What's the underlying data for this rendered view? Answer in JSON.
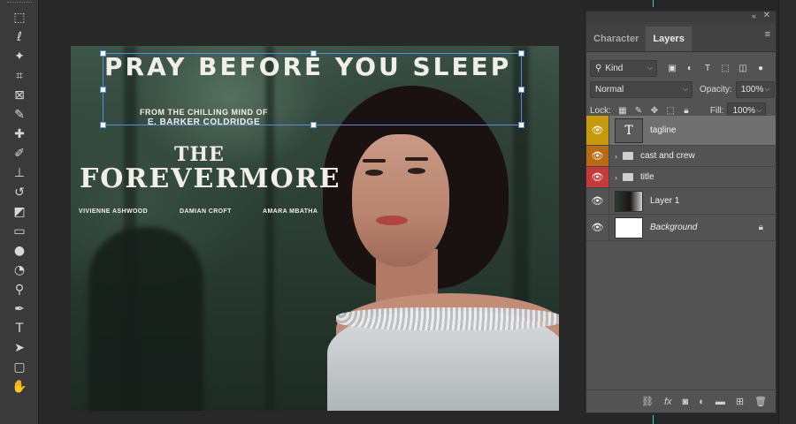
{
  "toolbar": {
    "tools": [
      {
        "icon": "rect-marquee-icon",
        "glyph": "⬚"
      },
      {
        "icon": "lasso-icon",
        "glyph": "ℓ"
      },
      {
        "icon": "magic-wand-icon",
        "glyph": "✦"
      },
      {
        "icon": "crop-icon",
        "glyph": "⌗"
      },
      {
        "icon": "frame-icon",
        "glyph": "⊠"
      },
      {
        "icon": "eyedropper-icon",
        "glyph": "✎"
      },
      {
        "icon": "healing-brush-icon",
        "glyph": "✚"
      },
      {
        "icon": "brush-icon",
        "glyph": "✐"
      },
      {
        "icon": "clone-stamp-icon",
        "glyph": "⊥"
      },
      {
        "icon": "history-brush-icon",
        "glyph": "↺"
      },
      {
        "icon": "eraser-icon",
        "glyph": "◩"
      },
      {
        "icon": "gradient-icon",
        "glyph": "▭"
      },
      {
        "icon": "blur-icon",
        "glyph": "●"
      },
      {
        "icon": "dodge-icon",
        "glyph": "◔"
      },
      {
        "icon": "zoom-icon",
        "glyph": "⚲"
      },
      {
        "icon": "pen-icon",
        "glyph": "✒"
      },
      {
        "icon": "type-icon",
        "glyph": "T"
      },
      {
        "icon": "path-select-icon",
        "glyph": "➤"
      },
      {
        "icon": "rectangle-shape-icon",
        "glyph": "▢"
      },
      {
        "icon": "hand-icon",
        "glyph": "✋"
      }
    ]
  },
  "poster": {
    "tagline": "PRAY BEFORE YOU SLEEP",
    "from_line_1": "FROM THE CHILLING MIND OF",
    "from_line_2": "E. BARKER COLDRIDGE",
    "title_the": "THE",
    "title_main": "FOREVERMORE",
    "cast": [
      "VIVIENNE ASHWOOD",
      "DAMIAN CROFT",
      "AMARA MBATHA"
    ]
  },
  "panel": {
    "tabs": [
      "Character",
      "Layers"
    ],
    "active_tab": "Layers",
    "filter_kind": "Kind",
    "blend_mode": "Normal",
    "opacity_label": "Opacity:",
    "opacity_value": "100%",
    "lock_label": "Lock:",
    "fill_label": "Fill:",
    "fill_value": "100%",
    "layers": [
      {
        "name": "tagline",
        "type": "text",
        "color": "#c69a0d",
        "selected": true
      },
      {
        "name": "cast and crew",
        "type": "group",
        "color": "#b86b12"
      },
      {
        "name": "title",
        "type": "group",
        "color": "#c43b3b"
      },
      {
        "name": "Layer 1",
        "type": "image"
      },
      {
        "name": "Background",
        "type": "background",
        "locked": true
      }
    ],
    "footer_icons": [
      "link-icon",
      "fx-icon",
      "mask-icon",
      "adjustment-icon",
      "new-group-icon",
      "new-layer-icon",
      "trash-icon"
    ]
  }
}
